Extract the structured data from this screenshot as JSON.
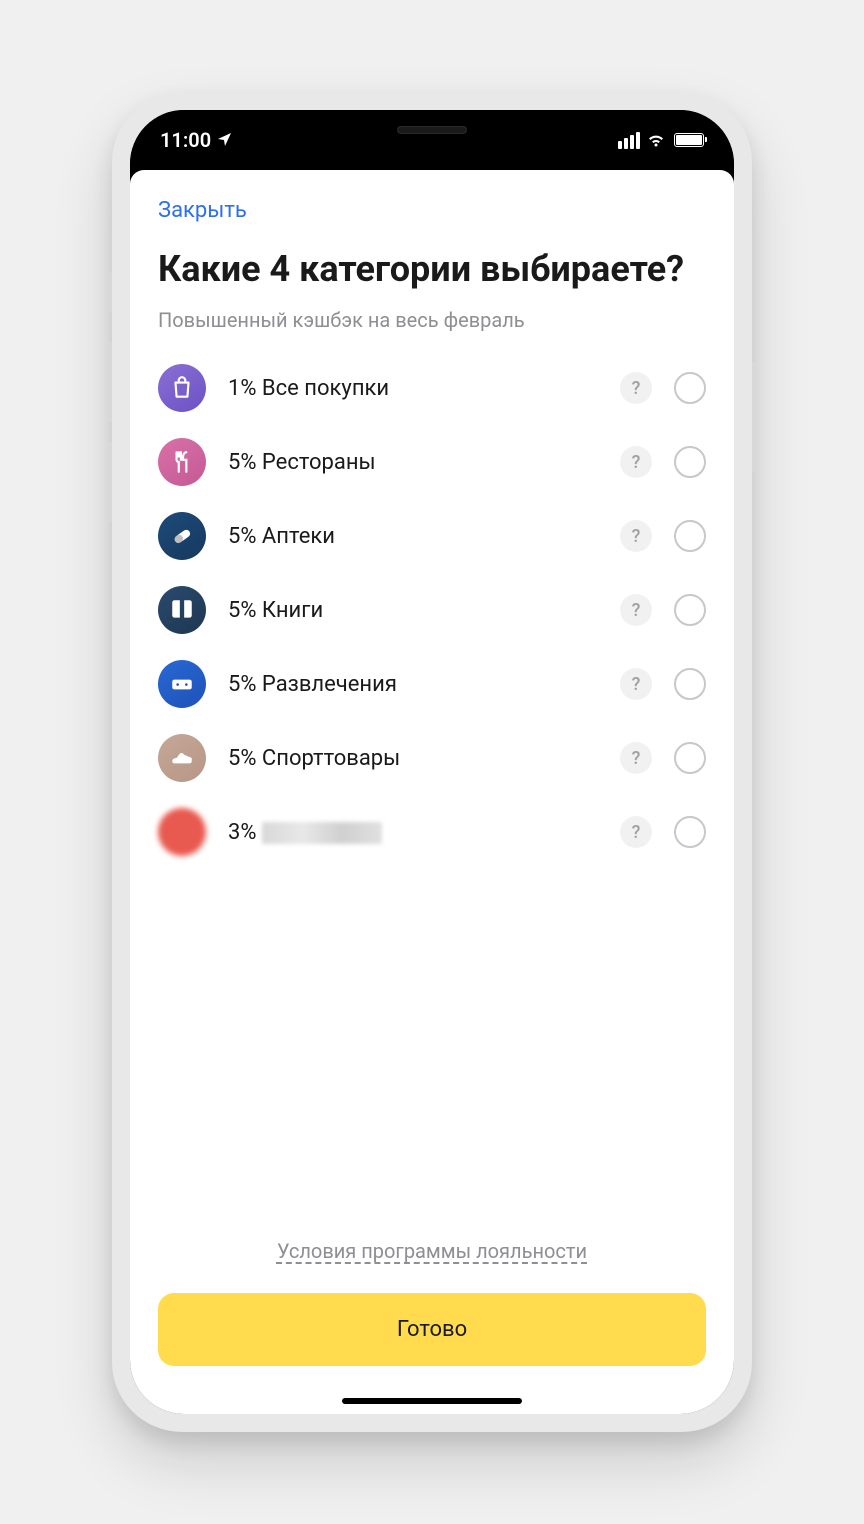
{
  "status_bar": {
    "time": "11:00"
  },
  "header": {
    "close_label": "Закрыть",
    "title": "Какие 4 категории выбираете?",
    "subtitle": "Повышенный кэшбэк на весь февраль"
  },
  "categories": [
    {
      "percent": "1%",
      "name": "Все покупки",
      "icon": "shopping-bag",
      "color_start": "#8b6fd4",
      "color_end": "#6b52c4"
    },
    {
      "percent": "5%",
      "name": "Рестораны",
      "icon": "restaurant",
      "color_start": "#d970a8",
      "color_end": "#c45a95"
    },
    {
      "percent": "5%",
      "name": "Аптеки",
      "icon": "pill",
      "color_start": "#1e4a7a",
      "color_end": "#16395f"
    },
    {
      "percent": "5%",
      "name": "Книги",
      "icon": "book",
      "color_start": "#2a4a6e",
      "color_end": "#1e3752"
    },
    {
      "percent": "5%",
      "name": "Развлечения",
      "icon": "gamepad",
      "color_start": "#2868d4",
      "color_end": "#1e52b8"
    },
    {
      "percent": "5%",
      "name": "Спорттовары",
      "icon": "sneaker",
      "color_start": "#c4a898",
      "color_end": "#b89685"
    },
    {
      "percent": "3%",
      "name": "",
      "icon": "blurred",
      "color_start": "#e85a4f",
      "color_end": "#e85a4f",
      "blurred": true
    }
  ],
  "footer": {
    "terms_label": "Условия программы лояльности",
    "done_label": "Готово"
  },
  "help_symbol": "?"
}
